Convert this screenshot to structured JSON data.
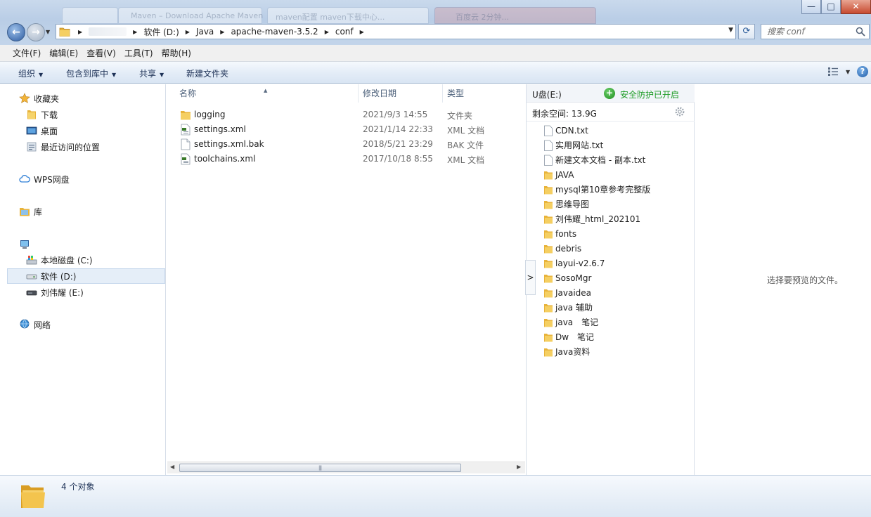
{
  "window": {
    "ghost_tabs": [
      "Maven – Download Apache Maven",
      "maven配置 maven下载中心...",
      "百度云 2分钟..."
    ],
    "close_symbol": "✕",
    "maximize_symbol": "□",
    "minimize_symbol": "—"
  },
  "navigation": {
    "back_symbol": "←",
    "forward_symbol": "→",
    "breadcrumbs": [
      "软件 (D:)",
      "Java",
      "apache-maven-3.5.2",
      "conf"
    ],
    "search_placeholder": "搜索 conf",
    "refresh_symbol": "⟳"
  },
  "menu": [
    "文件(F)",
    "编辑(E)",
    "查看(V)",
    "工具(T)",
    "帮助(H)"
  ],
  "commands": {
    "organize": "组织",
    "include_in_library": "包含到库中",
    "share": "共享",
    "new_folder": "新建文件夹",
    "help_symbol": "?"
  },
  "sidebar": {
    "favorites": "收藏夹",
    "downloads": "下载",
    "desktop": "桌面",
    "recent": "最近访问的位置",
    "wps_cloud": "WPS网盘",
    "libraries": "库",
    "drive_c": "本地磁盘 (C:)",
    "drive_d": "软件 (D:)",
    "drive_e": "刘伟耀 (E:)",
    "network": "网络"
  },
  "file_list": {
    "columns": {
      "name": "名称",
      "date": "修改日期",
      "type": "类型"
    },
    "files": [
      {
        "name": "logging",
        "date": "2021/9/3 14:55",
        "type": "文件夹",
        "icon": "folder-icon"
      },
      {
        "name": "settings.xml",
        "date": "2021/1/14 22:33",
        "type": "XML 文档",
        "icon": "xml-file-icon"
      },
      {
        "name": "settings.xml.bak",
        "date": "2018/5/21 23:29",
        "type": "BAK 文件",
        "icon": "file-icon"
      },
      {
        "name": "toolchains.xml",
        "date": "2017/10/18 8:55",
        "type": "XML 文档",
        "icon": "xml-file-icon"
      }
    ]
  },
  "usb_panel": {
    "title": "U盘(E:)",
    "protection_status": "安全防护已开启",
    "free_space": "剩余空间: 13.9G",
    "toggle_symbol": ">",
    "items": [
      {
        "name": "CDN.txt",
        "kind": "file"
      },
      {
        "name": "实用网站.txt",
        "kind": "file"
      },
      {
        "name": "新建文本文档 - 副本.txt",
        "kind": "file"
      },
      {
        "name": "JAVA",
        "kind": "folder"
      },
      {
        "name": "mysql第10章参考完整版",
        "kind": "folder"
      },
      {
        "name": "思维导图",
        "kind": "folder"
      },
      {
        "name": "刘伟耀_html_202101",
        "kind": "folder"
      },
      {
        "name": "fonts",
        "kind": "folder"
      },
      {
        "name": "debris",
        "kind": "folder"
      },
      {
        "name": "layui-v2.6.7",
        "kind": "folder"
      },
      {
        "name": "SosoMgr",
        "kind": "folder"
      },
      {
        "name": "Javaidea",
        "kind": "folder"
      },
      {
        "name": "java 辅助",
        "kind": "folder"
      },
      {
        "name": "java　笔记",
        "kind": "folder"
      },
      {
        "name": "Dw　笔记",
        "kind": "folder"
      },
      {
        "name": "Java资料",
        "kind": "folder"
      }
    ]
  },
  "preview": {
    "message": "选择要预览的文件。"
  },
  "details": {
    "item_count": "4 个对象"
  },
  "colors": {
    "accent": "#2c5aa0",
    "folder": "#e8b33a",
    "protect_green": "#1f9d27"
  }
}
